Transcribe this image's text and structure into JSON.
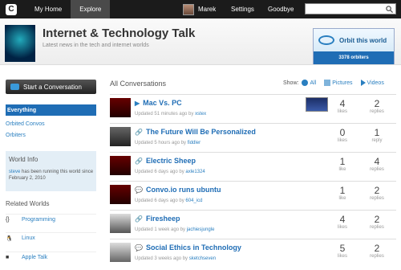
{
  "topbar": {
    "logo": "C",
    "nav": [
      "My Home",
      "Explore"
    ],
    "user": "Marek",
    "settings": "Settings",
    "goodbye": "Goodbye"
  },
  "world": {
    "title": "Internet & Technology Talk",
    "subtitle": "Latest news in the tech and internet worlds",
    "orbit_label": "Orbit this world",
    "orbit_count": "3378 orbiters"
  },
  "sidebar": {
    "start": "Start a Conversation",
    "items": [
      "Everything",
      "Orbited Convos",
      "Orbiters"
    ],
    "info_title": "World Info",
    "info_user": "steve",
    "info_text": "has been running this world since February 2, 2010",
    "related_title": "Related Worlds",
    "related": [
      {
        "icon": "{}",
        "name": "Programming"
      },
      {
        "icon": "🐧",
        "name": "Linux"
      },
      {
        "icon": "",
        "name": "Apple Talk"
      }
    ]
  },
  "main": {
    "heading": "All Conversations",
    "show_label": "Show:",
    "filters": [
      "All",
      "Pictures",
      "Videos"
    ]
  },
  "conversations": [
    {
      "icon": "▶",
      "title": "Mac Vs. PC",
      "updated": "Updated 51 minutes ago by",
      "user": "xstex",
      "likes": "4",
      "likes_label": "likes",
      "replies": "2",
      "replies_label": "replies"
    },
    {
      "icon": "🔗",
      "title": "The Future Will Be Personalized",
      "updated": "Updated 5 hours ago by",
      "user": "fiddler",
      "likes": "0",
      "likes_label": "likes",
      "replies": "1",
      "replies_label": "reply"
    },
    {
      "icon": "🔗",
      "title": "Electric Sheep",
      "updated": "Updated 6 days ago by",
      "user": "axle1324",
      "likes": "1",
      "likes_label": "like",
      "replies": "4",
      "replies_label": "replies"
    },
    {
      "icon": "💬",
      "title": "Convo.io runs ubuntu",
      "updated": "Updated 6 days ago by",
      "user": "604_icd",
      "likes": "1",
      "likes_label": "like",
      "replies": "2",
      "replies_label": "replies"
    },
    {
      "icon": "🔗",
      "title": "Firesheep",
      "updated": "Updated 1 week ago by",
      "user": "jachiesjungle",
      "likes": "4",
      "likes_label": "likes",
      "replies": "2",
      "replies_label": "replies"
    },
    {
      "icon": "💬",
      "title": "Social Ethics in Technology",
      "updated": "Updated 3 weeks ago by",
      "user": "sketchseven",
      "likes": "5",
      "likes_label": "likes",
      "replies": "2",
      "replies_label": "replies"
    }
  ]
}
